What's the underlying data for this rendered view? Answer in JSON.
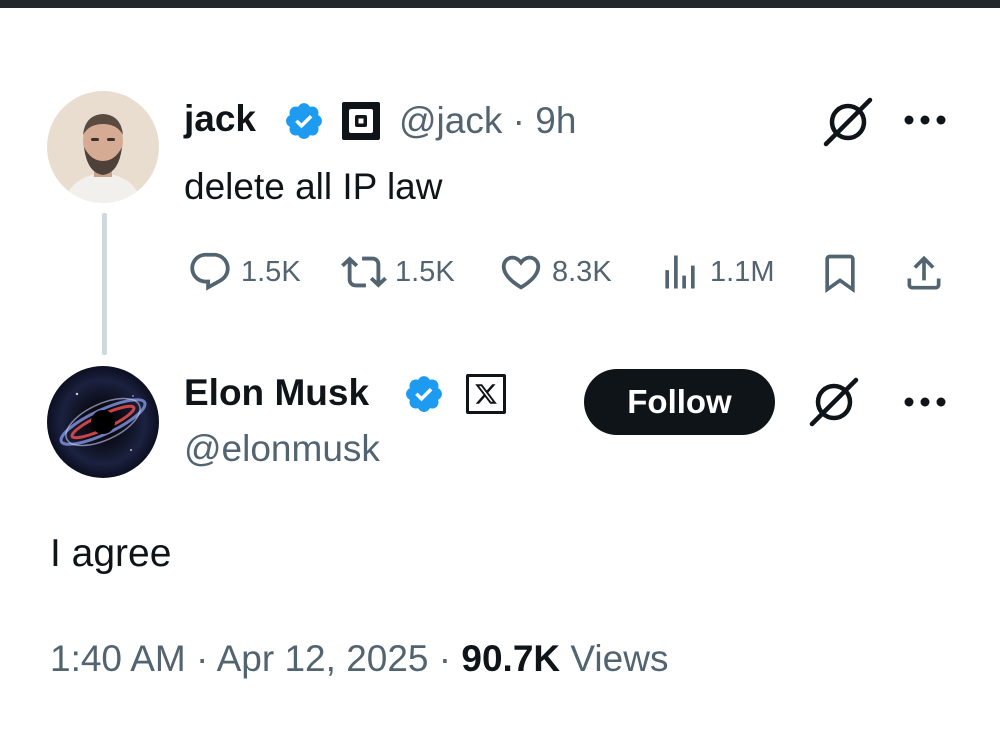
{
  "reply_to": {
    "display_name": "jack",
    "handle": "@jack",
    "separator": "·",
    "time": "9h",
    "text": "delete all IP law",
    "metrics": {
      "replies": "1.5K",
      "reposts": "1.5K",
      "likes": "8.3K",
      "views": "1.1M"
    },
    "icons": [
      "verified-badge-icon",
      "square-affiliate-icon",
      "grok-icon",
      "more-icon",
      "reply-icon",
      "repost-icon",
      "like-icon",
      "views-icon",
      "bookmark-icon",
      "share-icon"
    ]
  },
  "main_tweet": {
    "display_name": "Elon Musk",
    "handle": "@elonmusk",
    "follow_label": "Follow",
    "text": "I agree",
    "time": "1:40 AM",
    "separator1": "·",
    "date": "Apr 12, 2025",
    "separator2": "·",
    "views_count": "90.7K",
    "views_label": "Views",
    "icons": [
      "verified-badge-icon",
      "x-affiliate-icon",
      "grok-icon",
      "more-icon"
    ]
  },
  "colors": {
    "verified": "#1d9bf0",
    "text": "#0f1419",
    "secondary": "#536471",
    "thread_line": "#cfd9de",
    "follow_bg": "#0f1419"
  }
}
